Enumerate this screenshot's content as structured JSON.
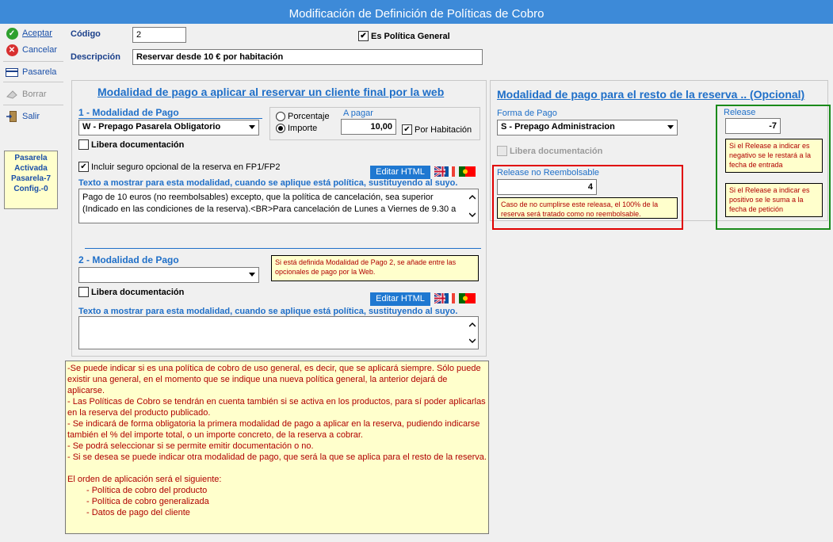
{
  "window": {
    "title": "Modificación de Definición de Políticas de Cobro"
  },
  "toolbar": {
    "aceptar": "Aceptar",
    "cancelar": "Cancelar",
    "pasarela": "Pasarela",
    "borrar": "Borrar",
    "salir": "Salir",
    "status_lines": [
      "Pasarela",
      "Activada",
      "Pasarela-7",
      "Config.-0"
    ]
  },
  "header": {
    "codigo_label": "Código",
    "codigo_value": "2",
    "es_politica_general_label": "Es Política General",
    "es_politica_general_checked": true,
    "descripcion_label": "Descripción",
    "descripcion_value": "Reservar desde 10 € por habitación"
  },
  "left_panel": {
    "title": "Modalidad de pago a aplicar al reservar un cliente final por la web",
    "mod1": {
      "title": "1 - Modalidad de Pago",
      "select_value": "W - Prepago Pasarela Obligatorio",
      "porcentaje_label": "Porcentaje",
      "importe_label": "Importe",
      "selected_radio": "Importe",
      "a_pagar_label": "A pagar",
      "a_pagar_value": "10,00",
      "por_habitacion_label": "Por Habitación",
      "por_habitacion_checked": true,
      "libera_label": "Libera documentación",
      "libera_checked": false,
      "seguro_label": "Incluir seguro opcional de la reserva en FP1/FP2",
      "seguro_checked": true,
      "editar_html": "Editar HTML",
      "texto_label": "Texto a mostrar para esta modalidad, cuando se aplique está política, sustituyendo al suyo.",
      "texto_value": "Pago de 10 euros (no reembolsables) excepto, que la política de cancelación, sea superior (Indicado en las condiciones de la reserva).<BR>Para cancelación de Lunes a Viernes de 9.30 a"
    },
    "mod2": {
      "title": "2 - Modalidad de Pago",
      "select_value": "",
      "note": "Si está definida Modalidad de Pago 2, se añade entre las opcionales de pago por la Web.",
      "libera_label": "Libera documentación",
      "libera_checked": false,
      "editar_html": "Editar HTML",
      "texto_label": "Texto a mostrar para esta modalidad, cuando se aplique está política, sustituyendo al suyo.",
      "texto_value": ""
    }
  },
  "right_panel": {
    "title": "Modalidad de pago para el resto de la reserva .. (Opcional)",
    "forma_pago_label": "Forma de Pago",
    "forma_pago_value": "S - Prepago Administracion",
    "libera_label": "Libera documentación",
    "release_nr_label": "Release no Reembolsable",
    "release_nr_value": "4",
    "release_nr_note": "Caso de no cumplirse este releasa, el 100% de la reserva será tratado como no reembolsable.",
    "release_label": "Release",
    "release_value": "-7",
    "release_note_neg": "Si el Release a indicar es negativo se le restará a la fecha de entrada",
    "release_note_pos": "Si el Release a indicar es positivo se le suma a la fecha de petición"
  },
  "info_note": {
    "lines": [
      "-Se puede indicar si es una política de cobro de uso general, es decir, que se aplicará siempre. Sólo puede existir una general, en el momento que se indique una nueva política general, la anterior dejará de aplicarse.",
      "- Las Políticas de Cobro se tendrán en cuenta también si se activa en los productos, para sí poder aplicarlas",
      "en la reserva del producto publicado.",
      "- Se indicará de forma obligatoria la primera modalidad de pago a aplicar en la reserva, pudiendo indicarse también el % del importe total, o un importe concreto, de la reserva a cobrar.",
      "- Se podrá seleccionar si se permite emitir documentación o no.",
      "- Si se desea se puede indicar otra modalidad de pago, que será la que se aplica para el resto de la reserva.",
      "",
      "El orden de aplicación será el siguiente:"
    ],
    "order_items": [
      "- Política de cobro del producto",
      "- Política de cobro generalizada",
      "- Datos de pago del cliente"
    ]
  },
  "colors": {
    "title_bar": "#3d8ad8",
    "section_blue": "#1f6fc8",
    "note_bg": "#ffffcc",
    "note_text": "#b00000",
    "red_frame": "#e00000",
    "green_frame": "#1a8a1a"
  }
}
